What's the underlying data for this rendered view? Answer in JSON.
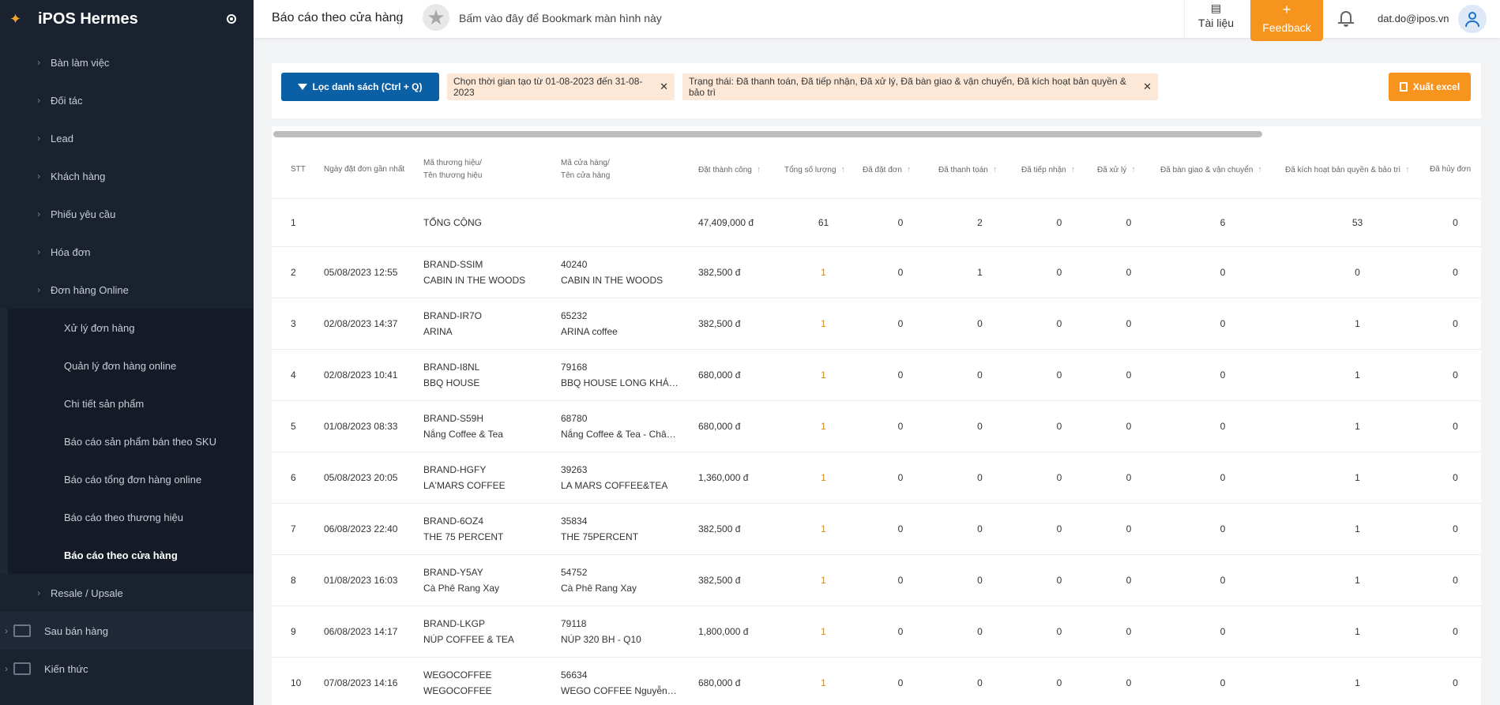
{
  "app": {
    "title": "iPOS Hermes"
  },
  "sidebar": {
    "items": [
      {
        "label": "Bàn làm việc"
      },
      {
        "label": "Đối tác"
      },
      {
        "label": "Lead"
      },
      {
        "label": "Khách hàng"
      },
      {
        "label": "Phiếu yêu cầu"
      },
      {
        "label": "Hóa đơn"
      },
      {
        "label": "Đơn hàng Online"
      }
    ],
    "sub_items": [
      {
        "label": "Xử lý đơn hàng"
      },
      {
        "label": "Quản lý đơn hàng online"
      },
      {
        "label": "Chi tiết sản phẩm"
      },
      {
        "label": "Báo cáo sản phẩm bán theo SKU"
      },
      {
        "label": "Báo cáo tổng đơn hàng online"
      },
      {
        "label": "Báo cáo theo thương hiệu"
      },
      {
        "label": "Báo cáo theo cửa hàng"
      }
    ],
    "after_items": [
      {
        "label": "Resale / Upsale"
      }
    ],
    "bottom_items": [
      {
        "label": "Sau bán hàng"
      },
      {
        "label": "Kiến thức"
      }
    ]
  },
  "header": {
    "page_title": "Báo cáo theo cửa hàng",
    "bookmark_text": "Bấm vào đây để Bookmark màn hình này",
    "docs_label": "Tài liệu",
    "feedback_label": "Feedback",
    "feedback_plus": "+",
    "user_email": "dat.do@ipos.vn"
  },
  "filters": {
    "filter_button": "Lọc danh sách (Ctrl + Q)",
    "chip_time": "Chọn thời gian tạo từ 01-08-2023 đến 31-08-2023",
    "chip_status": "Trạng thái: Đã thanh toán, Đã tiếp nhận, Đã xử lý, Đã bàn giao & vận chuyển, Đã kích hoạt bản quyền & bảo trì",
    "export_button": "Xuất excel"
  },
  "table": {
    "headers": {
      "stt": "STT",
      "date": "Ngày đặt đơn gần nhất",
      "brand_1": "Mã thương hiệu/",
      "brand_2": "Tên thương hiệu",
      "store_1": "Mã cửa hàng/",
      "store_2": "Tên cửa hàng",
      "amount": "Đặt thành công",
      "qty": "Tổng số lượng",
      "ordered": "Đã đặt đơn",
      "paid": "Đã thanh toán",
      "received": "Đã tiếp nhận",
      "processed": "Đã xử lý",
      "delivered": "Đã bàn giao & vận chuyển",
      "activated": "Đã kích hoạt bản quyền & bảo trì",
      "cancelled": "Đã hủy đơn"
    },
    "total_row": {
      "stt": "1",
      "brand": "TỔNG CỘNG",
      "amount": "47,409,000 đ",
      "qty": "61",
      "ordered": "0",
      "paid": "2",
      "received": "0",
      "processed": "0",
      "delivered": "6",
      "activated": "53",
      "cancelled": "0"
    },
    "rows": [
      {
        "stt": "2",
        "date": "05/08/2023 12:55",
        "brand_code": "BRAND-SSIM",
        "brand_name": "CABIN IN THE WOODS",
        "store_code": "40240",
        "store_name": "CABIN IN THE WOODS",
        "amount": "382,500 đ",
        "qty": "1",
        "ordered": "0",
        "paid": "1",
        "received": "0",
        "processed": "0",
        "delivered": "0",
        "activated": "0",
        "cancelled": "0"
      },
      {
        "stt": "3",
        "date": "02/08/2023 14:37",
        "brand_code": "BRAND-IR7O",
        "brand_name": "ARINA",
        "store_code": "65232",
        "store_name": "ARINA coffee",
        "amount": "382,500 đ",
        "qty": "1",
        "ordered": "0",
        "paid": "0",
        "received": "0",
        "processed": "0",
        "delivered": "0",
        "activated": "1",
        "cancelled": "0"
      },
      {
        "stt": "4",
        "date": "02/08/2023 10:41",
        "brand_code": "BRAND-I8NL",
        "brand_name": "BBQ HOUSE",
        "store_code": "79168",
        "store_name": "BBQ HOUSE LONG KHÁNH",
        "amount": "680,000 đ",
        "qty": "1",
        "ordered": "0",
        "paid": "0",
        "received": "0",
        "processed": "0",
        "delivered": "0",
        "activated": "1",
        "cancelled": "0"
      },
      {
        "stt": "5",
        "date": "01/08/2023 08:33",
        "brand_code": "BRAND-S59H",
        "brand_name": "Nắng Coffee & Tea",
        "store_code": "68780",
        "store_name": "Nắng Coffee & Tea - Châu ...",
        "amount": "680,000 đ",
        "qty": "1",
        "ordered": "0",
        "paid": "0",
        "received": "0",
        "processed": "0",
        "delivered": "0",
        "activated": "1",
        "cancelled": "0"
      },
      {
        "stt": "6",
        "date": "05/08/2023 20:05",
        "brand_code": "BRAND-HGFY",
        "brand_name": "LA'MARS COFFEE",
        "store_code": "39263",
        "store_name": "LA MARS COFFEE&TEA",
        "amount": "1,360,000 đ",
        "qty": "1",
        "ordered": "0",
        "paid": "0",
        "received": "0",
        "processed": "0",
        "delivered": "0",
        "activated": "1",
        "cancelled": "0"
      },
      {
        "stt": "7",
        "date": "06/08/2023 22:40",
        "brand_code": "BRAND-6OZ4",
        "brand_name": "THE 75 PERCENT",
        "store_code": "35834",
        "store_name": "THE 75PERCENT",
        "amount": "382,500 đ",
        "qty": "1",
        "ordered": "0",
        "paid": "0",
        "received": "0",
        "processed": "0",
        "delivered": "0",
        "activated": "1",
        "cancelled": "0"
      },
      {
        "stt": "8",
        "date": "01/08/2023 16:03",
        "brand_code": "BRAND-Y5AY",
        "brand_name": "Cà Phê Rang Xay",
        "store_code": "54752",
        "store_name": "Cà Phê Rang Xay",
        "amount": "382,500 đ",
        "qty": "1",
        "ordered": "0",
        "paid": "0",
        "received": "0",
        "processed": "0",
        "delivered": "0",
        "activated": "1",
        "cancelled": "0"
      },
      {
        "stt": "9",
        "date": "06/08/2023 14:17",
        "brand_code": "BRAND-LKGP",
        "brand_name": "NÚP COFFEE & TEA",
        "store_code": "79118",
        "store_name": "NÚP 320 BH - Q10",
        "amount": "1,800,000 đ",
        "qty": "1",
        "ordered": "0",
        "paid": "0",
        "received": "0",
        "processed": "0",
        "delivered": "0",
        "activated": "1",
        "cancelled": "0"
      },
      {
        "stt": "10",
        "date": "07/08/2023 14:16",
        "brand_code": "WEGOCOFFEE",
        "brand_name": "WEGOCOFFEE",
        "store_code": "56634",
        "store_name": "WEGO COFFEE Nguyễn Vă...",
        "amount": "680,000 đ",
        "qty": "1",
        "ordered": "0",
        "paid": "0",
        "received": "0",
        "processed": "0",
        "delivered": "0",
        "activated": "1",
        "cancelled": "0"
      }
    ]
  }
}
